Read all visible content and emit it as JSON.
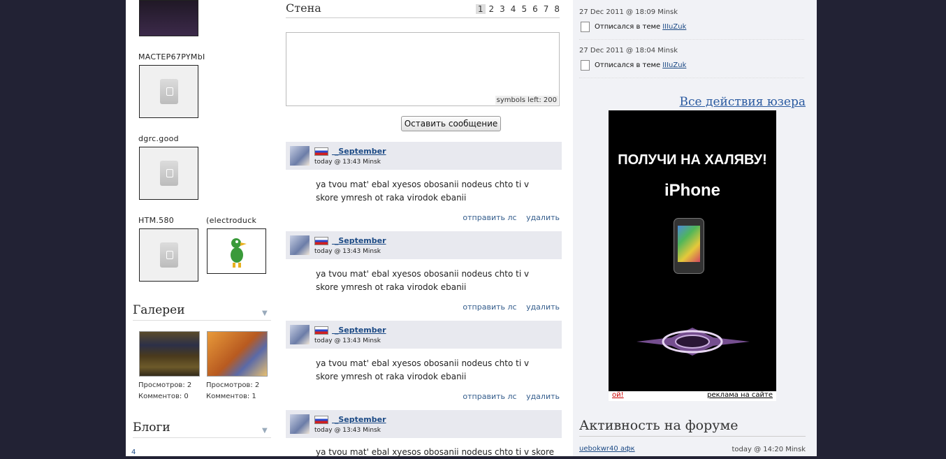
{
  "left": {
    "users": [
      {
        "name": "MACTEP67PYMbI"
      },
      {
        "name": "dgrc.good"
      },
      {
        "name": "HTM.580"
      },
      {
        "name": "(electroduck"
      }
    ],
    "gallery": {
      "title": "Галереи",
      "items": [
        {
          "views": "Просмотров: 2",
          "comments": "Комментов: 0"
        },
        {
          "views": "Просмотров: 2",
          "comments": "Комментов: 1"
        }
      ]
    },
    "blogs": {
      "title": "Блоги",
      "count": "4"
    }
  },
  "wall": {
    "title": "Стена",
    "pages": [
      "1",
      "2",
      "3",
      "4",
      "5",
      "6",
      "7",
      "8"
    ],
    "symbols_left": "symbols left: 200",
    "submit_label": "Оставить сообщение",
    "posts": [
      {
        "author": " _September",
        "date": "today @ 13:43 Minsk",
        "text": "ya tvou mat' ebal xyesos obosanii nodeus chto ti v skore ymresh ot raka virodok ebanii",
        "send_pm": "отправить лс",
        "delete": "удалить"
      },
      {
        "author": " _September",
        "date": "today @ 13:43 Minsk",
        "text": "ya tvou mat' ebal xyesos obosanii nodeus chto ti v skore ymresh ot raka virodok ebanii",
        "send_pm": "отправить лс",
        "delete": "удалить"
      },
      {
        "author": " _September",
        "date": "today @ 13:43 Minsk",
        "text": "ya tvou mat' ebal xyesos obosanii nodeus chto ti v skore ymresh ot raka virodok ebanii",
        "send_pm": "отправить лс",
        "delete": "удалить"
      },
      {
        "author": " _September",
        "date": "today @ 13:43 Minsk",
        "text": "ya tvou mat' ebal xyesos obosanii nodeus chto ti v skore",
        "send_pm": "",
        "delete": ""
      }
    ]
  },
  "activity": {
    "events": [
      {
        "date": "27 Dec 2011 @ 18:09 Minsk",
        "action": "Отписался в теме",
        "link": "IIIuZuk"
      },
      {
        "date": "27 Dec 2011 @ 18:04 Minsk",
        "action": "Отписался в теме",
        "link": "IIIuZuk"
      }
    ],
    "all_actions": "Все действия юзера"
  },
  "ad": {
    "line1": "ПОЛУЧИ НА ХАЛЯВУ!",
    "line2": "iPhone",
    "oops": "ой!",
    "site_ad": "реклама на сайте"
  },
  "forum": {
    "title": "Активность на форуме",
    "items": [
      {
        "user": "uebokwr40 афк",
        "time": "today @ 14:20 Minsk"
      }
    ]
  },
  "icons": [
    "no-avatar-icon",
    "arrow-down-icon",
    "flag-russia-icon",
    "note-icon"
  ]
}
